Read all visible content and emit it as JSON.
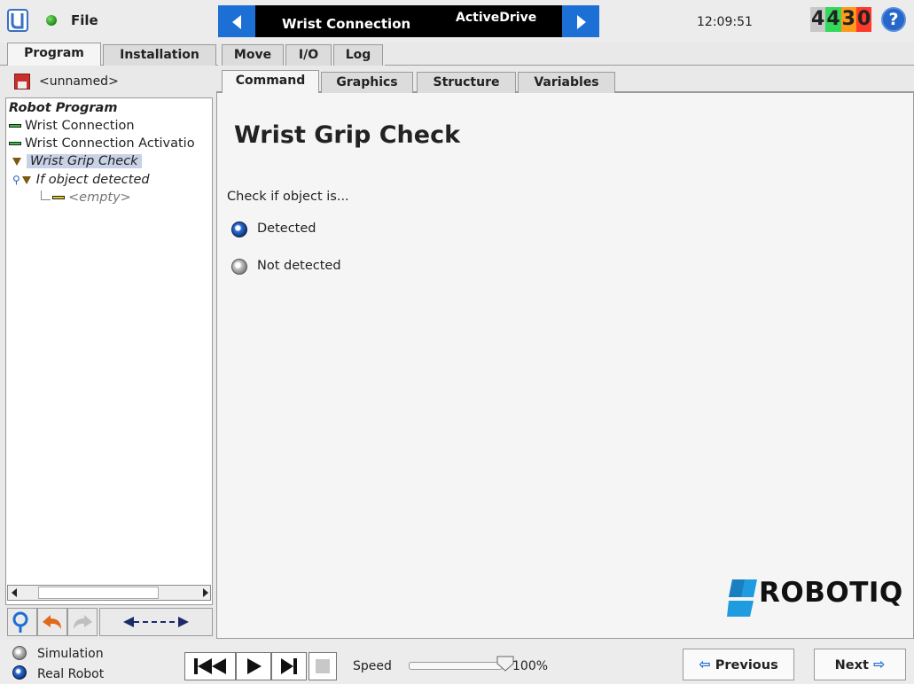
{
  "topbar": {
    "file_label": "File",
    "program_name": "Wrist Connection",
    "nav_sub": "ActiveDrive",
    "clock": "12:09:51",
    "serial": [
      "4",
      "4",
      "3",
      "0"
    ],
    "serial_colors": [
      "#c8c8c8",
      "#33d95a",
      "#ff9a1a",
      "#ff3a2a"
    ],
    "help_glyph": "?"
  },
  "main_tabs": [
    "Program",
    "Installation",
    "Move",
    "I/O",
    "Log"
  ],
  "sub_tabs": [
    "Command",
    "Graphics",
    "Structure",
    "Variables"
  ],
  "program_file": "<unnamed>",
  "tree": {
    "root": "Robot Program",
    "items": [
      "Wrist Connection",
      "Wrist Connection Activatio",
      "Wrist Grip Check",
      "If object detected",
      "<empty>"
    ]
  },
  "command": {
    "title": "Wrist Grip Check",
    "check_label": "Check if object is...",
    "options": [
      "Detected",
      "Not detected"
    ],
    "selected": "Detected"
  },
  "brand": "ROBOTIQ",
  "bottom": {
    "modes": [
      "Simulation",
      "Real Robot"
    ],
    "speed_label": "Speed",
    "speed_value": "100%",
    "speed_fraction": 1.0,
    "previous_label": "Previous",
    "next_label": "Next"
  }
}
